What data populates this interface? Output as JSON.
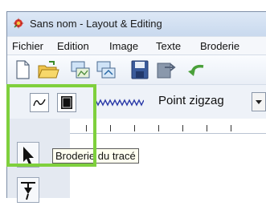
{
  "window": {
    "title": "Sans nom - Layout & Editing",
    "app_icon": "embroidery-app-icon"
  },
  "menu": {
    "items": [
      "Fichier",
      "Edition",
      "Image",
      "Texte",
      "Broderie"
    ]
  },
  "toolbar": {
    "buttons": [
      "new-file-icon",
      "open-folder-icon",
      "scan-image-icon",
      "import-image-icon",
      "save-icon",
      "send-to-card-icon",
      "undo-icon"
    ]
  },
  "stitch_bar": {
    "line_sew_icon": "line-sew-icon",
    "region_sew_icon": "region-sew-icon",
    "stitch_type": "Point zigzag"
  },
  "tooltip": {
    "text": "Broderie du tracé"
  },
  "tools": {
    "select": "arrow-select-icon",
    "pen": "pen-tool-icon"
  },
  "highlight_color": "#7fd03d"
}
